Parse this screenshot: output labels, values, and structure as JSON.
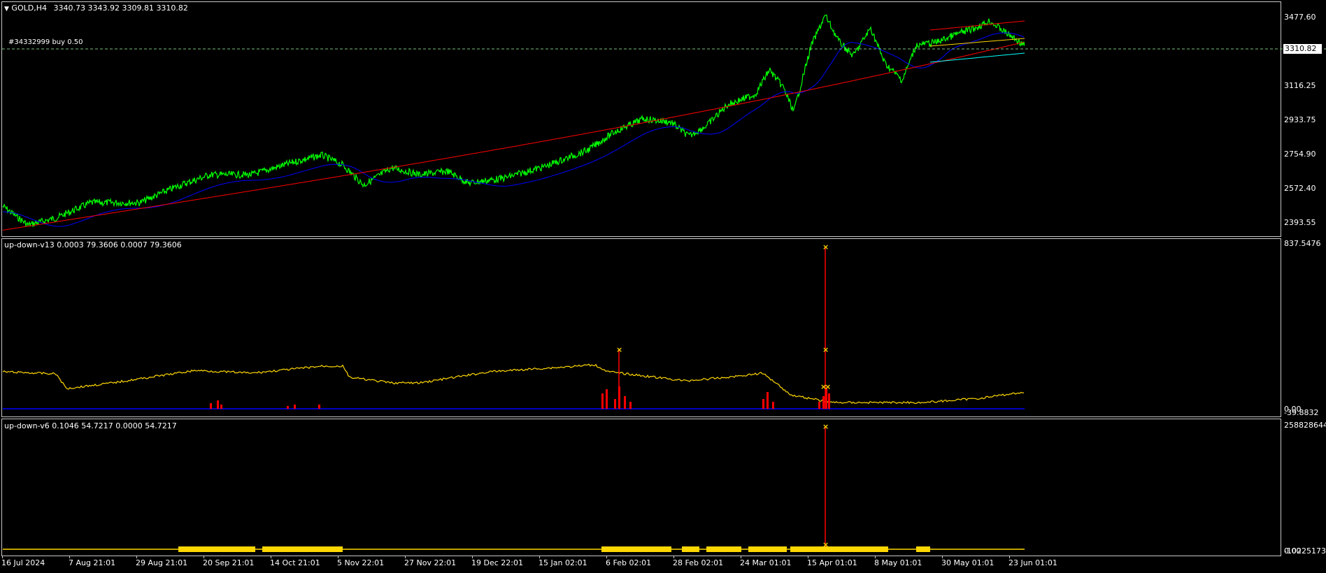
{
  "main": {
    "symbol_label": "GOLD,H4",
    "ohlc": "3340.73 3343.92 3309.81 3310.82",
    "order_label": "#34332999 buy 0.50",
    "current_price": "3310.82",
    "y_labels": [
      "3477.60",
      "3116.25",
      "2933.75",
      "2754.90",
      "2572.40",
      "2393.55"
    ]
  },
  "ind1": {
    "label": "up-down-v13 0.0003 79.3606 0.0007 79.3606",
    "y_top": "837.5476",
    "y_bottom_a": "0.00",
    "y_bottom_b": "-39.8832"
  },
  "ind2": {
    "label": "up-down-v6 0.1046 54.7217 0.0000 54.7217",
    "y_top": "258828644",
    "y_bottom_a": "0.00",
    "y_bottom_b": "-10225173"
  },
  "x_labels": [
    "16 Jul 2024",
    "7 Aug 21:01",
    "29 Aug 21:01",
    "20 Sep 21:01",
    "14 Oct 21:01",
    "5 Nov 22:01",
    "27 Nov 22:01",
    "19 Dec 22:01",
    "15 Jan 02:01",
    "6 Feb 02:01",
    "28 Feb 02:01",
    "24 Mar 01:01",
    "15 Apr 01:01",
    "8 May 01:01",
    "30 May 01:01",
    "23 Jun 01:01"
  ],
  "colors": {
    "price": "#00ff00",
    "ma_fast": "#0000ff",
    "ma_slow": "#ff0000",
    "indicator_line": "#ffd700",
    "histogram": "#ff0000",
    "channel_mid": "#ffd700",
    "channel_low": "#00ffff",
    "grid_border": "#c8c8c8"
  }
}
